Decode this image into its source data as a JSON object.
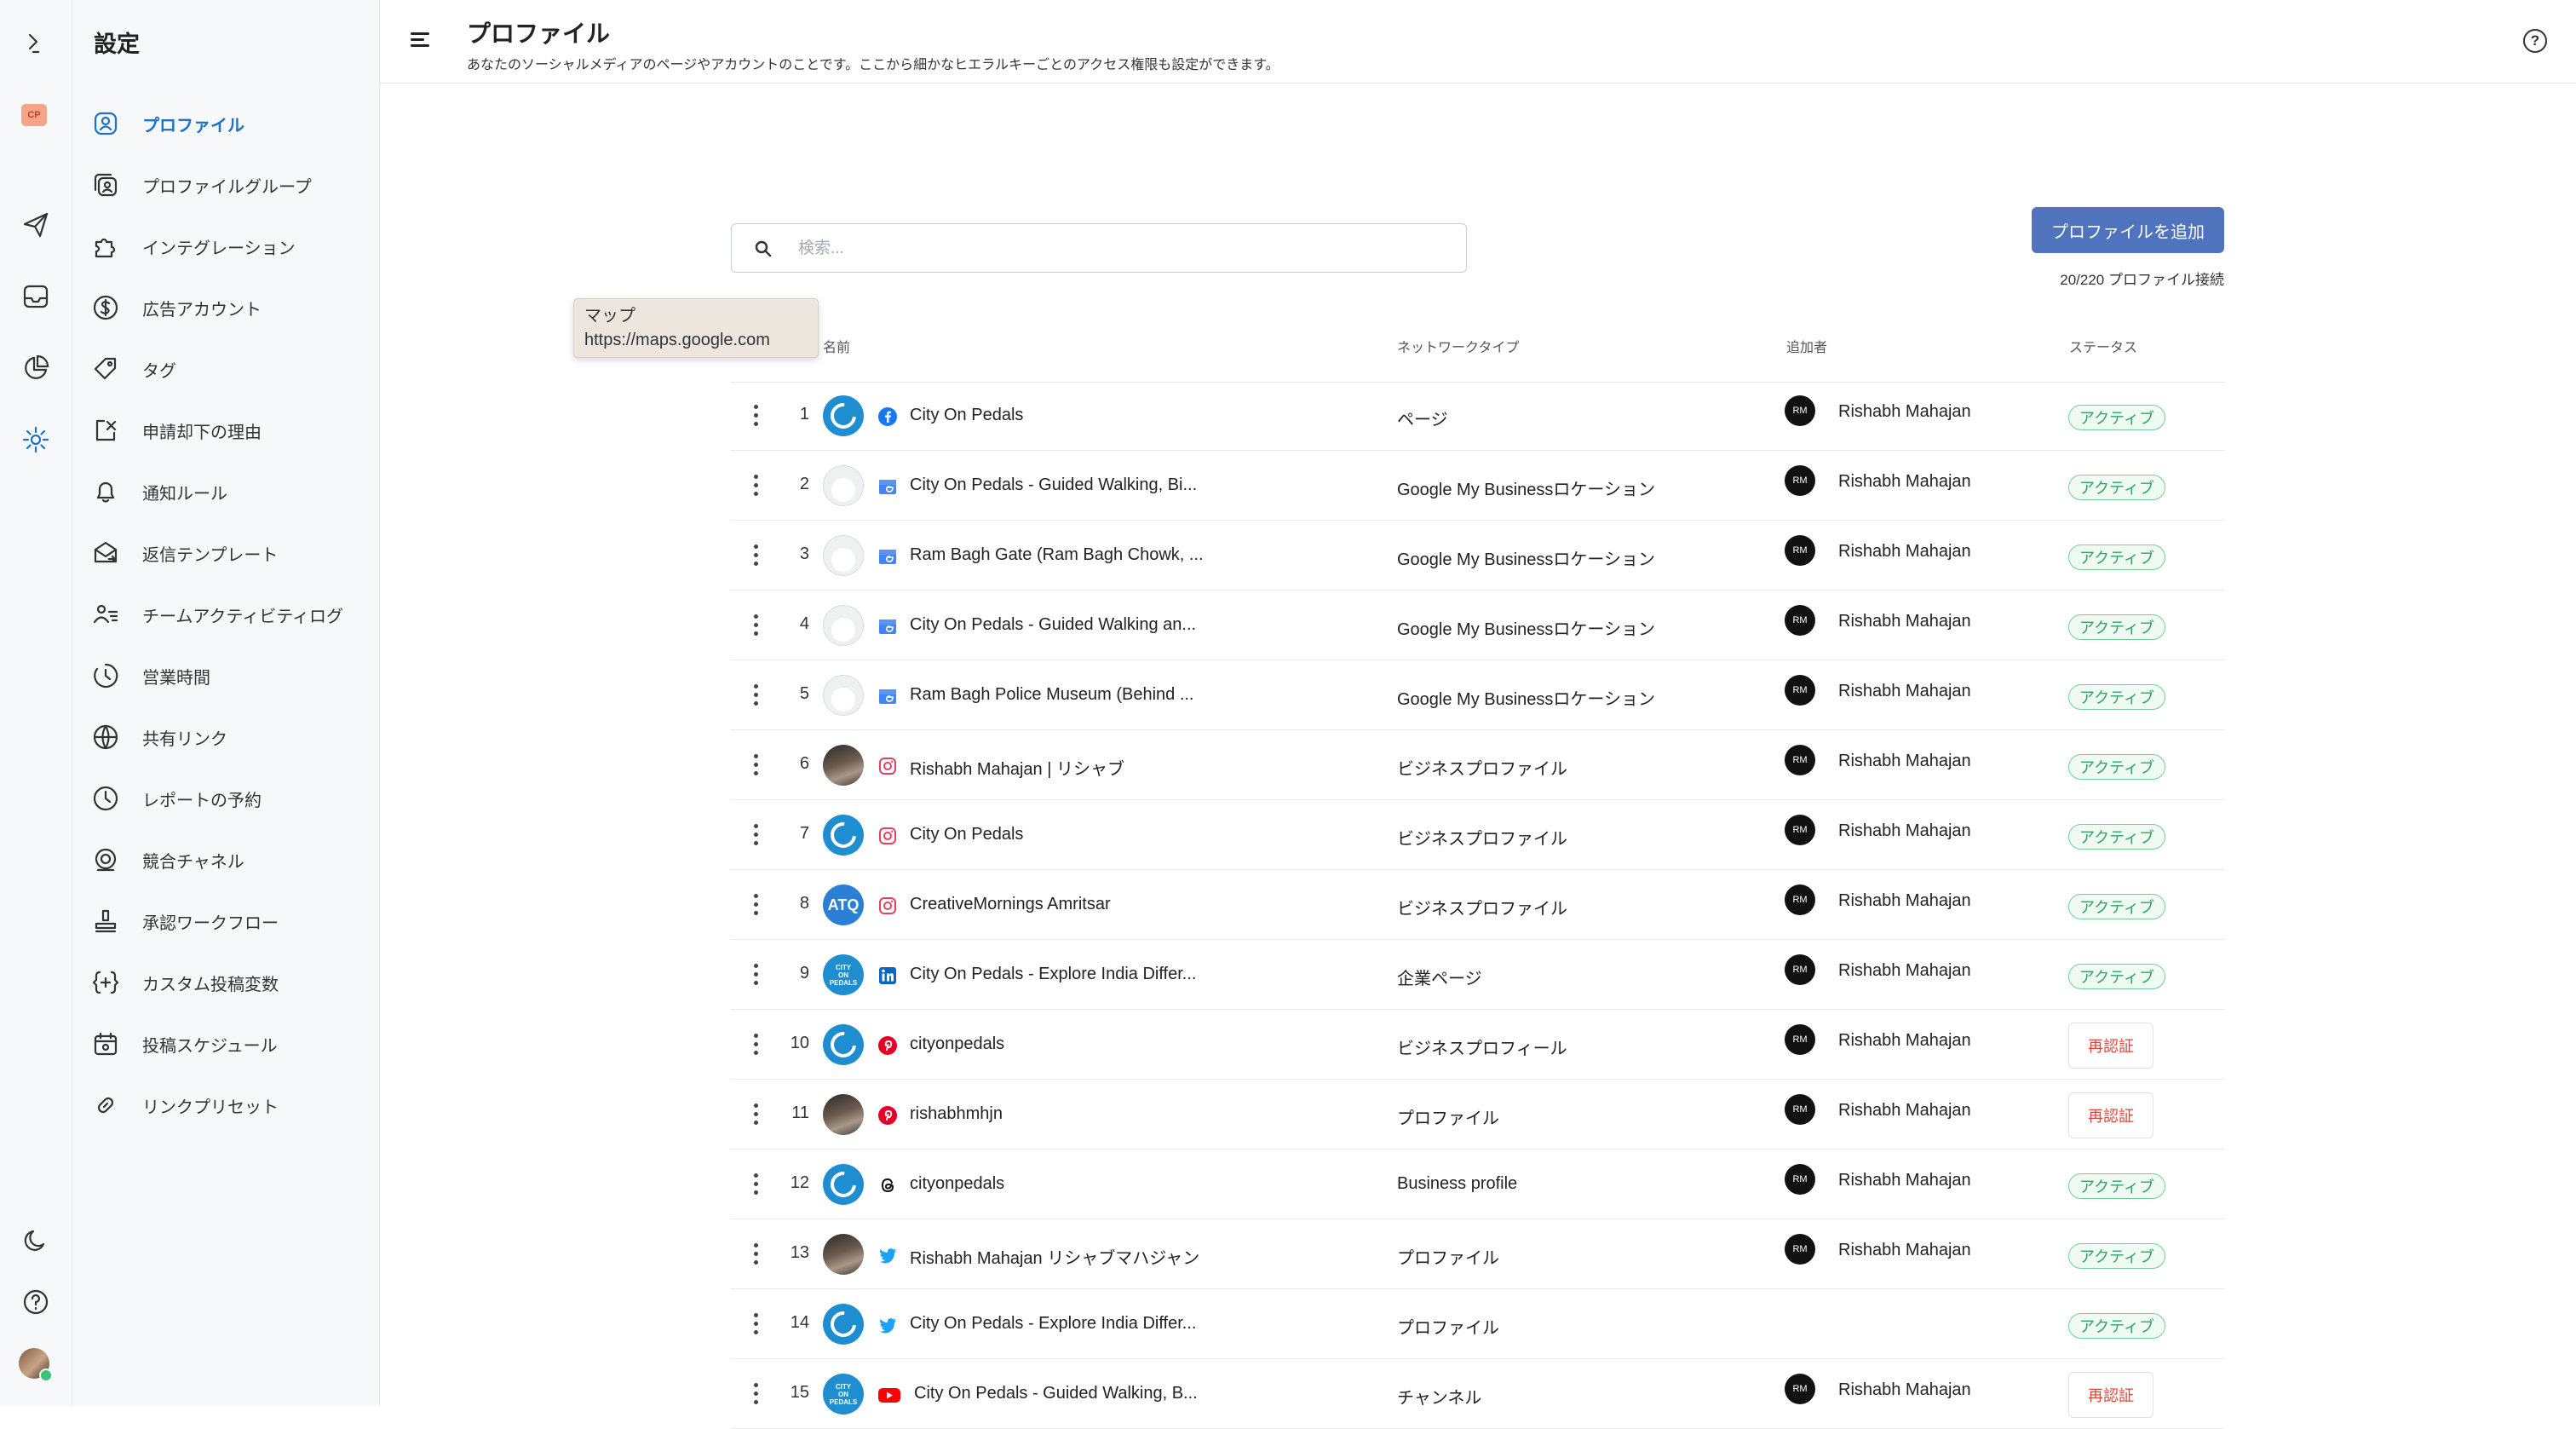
{
  "app": {
    "workspace_badge": "CP"
  },
  "sidebar": {
    "title": "設定",
    "items": [
      {
        "label": "プロファイル",
        "icon": "profile-icon",
        "active": true
      },
      {
        "label": "プロファイルグループ",
        "icon": "profile-group-icon"
      },
      {
        "label": "インテグレーション",
        "icon": "puzzle-icon"
      },
      {
        "label": "広告アカウント",
        "icon": "dollar-icon"
      },
      {
        "label": "タグ",
        "icon": "tag-icon"
      },
      {
        "label": "申請却下の理由",
        "icon": "rejection-icon"
      },
      {
        "label": "通知ルール",
        "icon": "bell-icon"
      },
      {
        "label": "返信テンプレート",
        "icon": "reply-template-icon"
      },
      {
        "label": "チームアクティビティログ",
        "icon": "team-activity-icon"
      },
      {
        "label": "営業時間",
        "icon": "business-hours-icon"
      },
      {
        "label": "共有リンク",
        "icon": "globe-icon"
      },
      {
        "label": "レポートの予約",
        "icon": "clock-icon"
      },
      {
        "label": "競合チャネル",
        "icon": "competitor-icon"
      },
      {
        "label": "承認ワークフロー",
        "icon": "stamp-icon"
      },
      {
        "label": "カスタム投稿変数",
        "icon": "variable-icon"
      },
      {
        "label": "投稿スケジュール",
        "icon": "calendar-icon"
      },
      {
        "label": "リンクプリセット",
        "icon": "link-icon"
      }
    ]
  },
  "header": {
    "title": "プロファイル",
    "description": "あなたのソーシャルメディアのページやアカウントのことです。ここから細かなヒエラルキーごとのアクセス権限も設定ができます。"
  },
  "search": {
    "placeholder": "検索..."
  },
  "toolbar": {
    "add_profile_label": "プロファイルを追加",
    "connection_count": "20/220 プロファイル接続"
  },
  "tooltip": {
    "line1": "マップ",
    "line2": "https://maps.google.com"
  },
  "table": {
    "headers": {
      "name": "名前",
      "network_type": "ネットワークタイプ",
      "added_by": "追加者",
      "status": "ステータス"
    },
    "rows": [
      {
        "num": "1",
        "avatar": "brand",
        "network": "facebook",
        "name": "City On Pedals",
        "type": "ページ",
        "adder_initials": "RM",
        "adder": "Rishabh Mahajan",
        "status": "アクティブ",
        "status_kind": "active"
      },
      {
        "num": "2",
        "avatar": "blank",
        "network": "google-my-business",
        "name": "City On Pedals - Guided Walking, Bi...",
        "type": "Google My Businessロケーション",
        "adder_initials": "RM",
        "adder": "Rishabh Mahajan",
        "status": "アクティブ",
        "status_kind": "active"
      },
      {
        "num": "3",
        "avatar": "blank",
        "network": "google-my-business",
        "name": "Ram Bagh Gate (Ram Bagh Chowk, ...",
        "type": "Google My Businessロケーション",
        "adder_initials": "RM",
        "adder": "Rishabh Mahajan",
        "status": "アクティブ",
        "status_kind": "active"
      },
      {
        "num": "4",
        "avatar": "blank",
        "network": "google-my-business",
        "name": "City On Pedals - Guided Walking an...",
        "type": "Google My Businessロケーション",
        "adder_initials": "RM",
        "adder": "Rishabh Mahajan",
        "status": "アクティブ",
        "status_kind": "active"
      },
      {
        "num": "5",
        "avatar": "blank",
        "network": "google-my-business",
        "name": "Ram Bagh Police Museum (Behind ...",
        "type": "Google My Businessロケーション",
        "adder_initials": "RM",
        "adder": "Rishabh Mahajan",
        "status": "アクティブ",
        "status_kind": "active"
      },
      {
        "num": "6",
        "avatar": "photo",
        "network": "instagram",
        "name": "Rishabh Mahajan | リシャブ",
        "type": "ビジネスプロファイル",
        "adder_initials": "RM",
        "adder": "Rishabh Mahajan",
        "status": "アクティブ",
        "status_kind": "active"
      },
      {
        "num": "7",
        "avatar": "brand",
        "network": "instagram",
        "name": "City On Pedals",
        "type": "ビジネスプロファイル",
        "adder_initials": "RM",
        "adder": "Rishabh Mahajan",
        "status": "アクティブ",
        "status_kind": "active"
      },
      {
        "num": "8",
        "avatar": "atq",
        "avatar_text": "ATQ",
        "network": "instagram",
        "name": "CreativeMornings Amritsar",
        "type": "ビジネスプロファイル",
        "adder_initials": "RM",
        "adder": "Rishabh Mahajan",
        "status": "アクティブ",
        "status_kind": "active"
      },
      {
        "num": "9",
        "avatar": "city",
        "network": "linkedin",
        "name": "City On Pedals - Explore India Differ...",
        "type": "企業ページ",
        "adder_initials": "RM",
        "adder": "Rishabh Mahajan",
        "status": "アクティブ",
        "status_kind": "active"
      },
      {
        "num": "10",
        "avatar": "brand",
        "network": "pinterest",
        "name": "cityonpedals",
        "type": "ビジネスプロフィール",
        "adder_initials": "RM",
        "adder": "Rishabh Mahajan",
        "status": "再認証",
        "status_kind": "reauth"
      },
      {
        "num": "11",
        "avatar": "photo",
        "network": "pinterest",
        "name": "rishabhmhjn",
        "type": "プロファイル",
        "adder_initials": "RM",
        "adder": "Rishabh Mahajan",
        "status": "再認証",
        "status_kind": "reauth"
      },
      {
        "num": "12",
        "avatar": "brand",
        "network": "threads",
        "name": "cityonpedals",
        "type": "Business profile",
        "adder_initials": "RM",
        "adder": "Rishabh Mahajan",
        "status": "アクティブ",
        "status_kind": "active"
      },
      {
        "num": "13",
        "avatar": "photo",
        "network": "twitter",
        "name": "Rishabh Mahajan リシャブマハジャン",
        "type": "プロファイル",
        "adder_initials": "RM",
        "adder": "Rishabh Mahajan",
        "status": "アクティブ",
        "status_kind": "active"
      },
      {
        "num": "14",
        "avatar": "brand",
        "network": "twitter",
        "name": "City On Pedals - Explore India Differ...",
        "type": "プロファイル",
        "adder_initials": "",
        "adder": "",
        "status": "アクティブ",
        "status_kind": "active"
      },
      {
        "num": "15",
        "avatar": "city",
        "network": "youtube",
        "name": "City On Pedals - Guided Walking, B...",
        "type": "チャンネル",
        "adder_initials": "RM",
        "adder": "Rishabh Mahajan",
        "status": "再認証",
        "status_kind": "reauth"
      }
    ]
  }
}
